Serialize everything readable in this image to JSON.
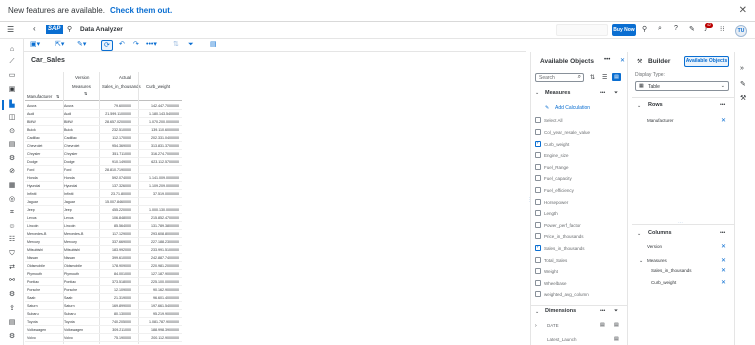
{
  "banner": {
    "message": "New features are available.",
    "link": "Check them out."
  },
  "shell": {
    "logo": "SAP",
    "app_title": "Data Analyzer",
    "buy_label": "Buy Now",
    "notification_count": "42",
    "user_initials": "TU"
  },
  "table": {
    "title": "Car_Sales",
    "header": {
      "version_label": "Version",
      "version_value": "Actual",
      "measures_label": "Measures",
      "measure1": "Sales_in_thousands",
      "measure2": "Curb_weight",
      "row_dim": "Manufacturer"
    },
    "rows": [
      [
        "Acura",
        "Acura",
        "79.600000",
        "142.447.7000000"
      ],
      [
        "Audi",
        "Audi",
        "21.599.1100000",
        "1.180.143.5400000"
      ],
      [
        "BMW",
        "BMW",
        "28.657.0200000",
        "1.070.200.0000000"
      ],
      [
        "Buick",
        "Buick",
        "232.510000",
        "139.110.6000000"
      ],
      [
        "Cadillac",
        "Cadillac",
        "112.170000",
        "202.331.0400000"
      ],
      [
        "Chevrolet",
        "Chevrolet",
        "954.369000",
        "313.831.3700000"
      ],
      [
        "Chrysler",
        "Chrysler",
        "351.711000",
        "316.274.7000000"
      ],
      [
        "Dodge",
        "Dodge",
        "910.149000",
        "623.112.5700000"
      ],
      [
        "Ford",
        "Ford",
        "28.810.7190000",
        ""
      ],
      [
        "Honda",
        "Honda",
        "592.074000",
        "1.141.009.0000000"
      ],
      [
        "Hyundai",
        "Hyundai",
        "137.326000",
        "1.109.209.0000000"
      ],
      [
        "Infiniti",
        "Infiniti",
        "23.71.80000",
        "37.519.0000000"
      ],
      [
        "Jaguar",
        "Jaguar",
        "15.007.8460000",
        ""
      ],
      [
        "Jeep",
        "Jeep",
        "455.220000",
        "1.000.130.0000000"
      ],
      [
        "Lexus",
        "Lexus",
        "106.848000",
        "215.852.4700000"
      ],
      [
        "Lincoln",
        "Lincoln",
        "85.564000",
        "131.789.3800000"
      ],
      [
        "Mercedes-B",
        "Mercedes-B",
        "117.129000",
        "293.608.8000000"
      ],
      [
        "Mercury",
        "Mercury",
        "337.669000",
        "227.188.2300000"
      ],
      [
        "Mitsubishi",
        "Mitsubishi",
        "183.992000",
        "233.991.5100000"
      ],
      [
        "Nissan",
        "Nissan",
        "399.610000",
        "242.887.7400000"
      ],
      [
        "Oldsmobile",
        "Oldsmobile",
        "178.909000",
        "220.981.2000000"
      ],
      [
        "Plymouth",
        "Plymouth",
        "84.001000",
        "127.187.9000000"
      ],
      [
        "Pontiac",
        "Pontiac",
        "373.518000",
        "225.100.0000000"
      ],
      [
        "Porsche",
        "Porsche",
        "12.109000",
        "90.162.9000000"
      ],
      [
        "Saab",
        "Saab",
        "21.319000",
        "96.601.4000000"
      ],
      [
        "Saturn",
        "Saturn",
        "169.899000",
        "197.661.5400000"
      ],
      [
        "Subaru",
        "Subaru",
        "80.130000",
        "95.219.9000000"
      ],
      [
        "Toyota",
        "Toyota",
        "740.205000",
        "1.081.787.9000000"
      ],
      [
        "Volkswagen",
        "Volkswagen",
        "309.211000",
        "188.998.3900000"
      ],
      [
        "Volvo",
        "Volvo",
        "75.190000",
        "200.112.9000000"
      ]
    ]
  },
  "available": {
    "title": "Available Objects",
    "search_placeholder": "Search",
    "measures_label": "Measures",
    "add_calc": "Add Calculation",
    "select_all": "Select All",
    "items": [
      {
        "label": "Col_year_resale_value",
        "checked": false
      },
      {
        "label": "Curb_weight",
        "checked": true
      },
      {
        "label": "Engine_size",
        "checked": false
      },
      {
        "label": "Fuel_Range",
        "checked": false
      },
      {
        "label": "Fuel_capacity",
        "checked": false
      },
      {
        "label": "Fuel_efficiency",
        "checked": false
      },
      {
        "label": "Horsepower",
        "checked": false
      },
      {
        "label": "Length",
        "checked": false
      },
      {
        "label": "Power_perf_factor",
        "checked": false
      },
      {
        "label": "Price_in_thousands",
        "checked": false
      },
      {
        "label": "Sales_in_thousands",
        "checked": true
      },
      {
        "label": "Total_Sales",
        "checked": false
      },
      {
        "label": "Weight",
        "checked": false
      },
      {
        "label": "Wheelbase",
        "checked": false
      },
      {
        "label": "weighted_avg_column",
        "checked": false
      }
    ],
    "dimensions_label": "Dimensions",
    "dim_items": [
      "DATE",
      "Latest_Launch"
    ]
  },
  "builder": {
    "title": "Builder",
    "tab_available": "Available Objects",
    "display_type_label": "Display Type:",
    "display_type_value": "Table",
    "rows_label": "Rows",
    "rows_items": [
      "Manufacturer"
    ],
    "columns_label": "Columns",
    "columns_version": "Version",
    "columns_measures": "Measures",
    "columns_items": [
      "Sales_in_thousands",
      "Curb_weight"
    ]
  }
}
